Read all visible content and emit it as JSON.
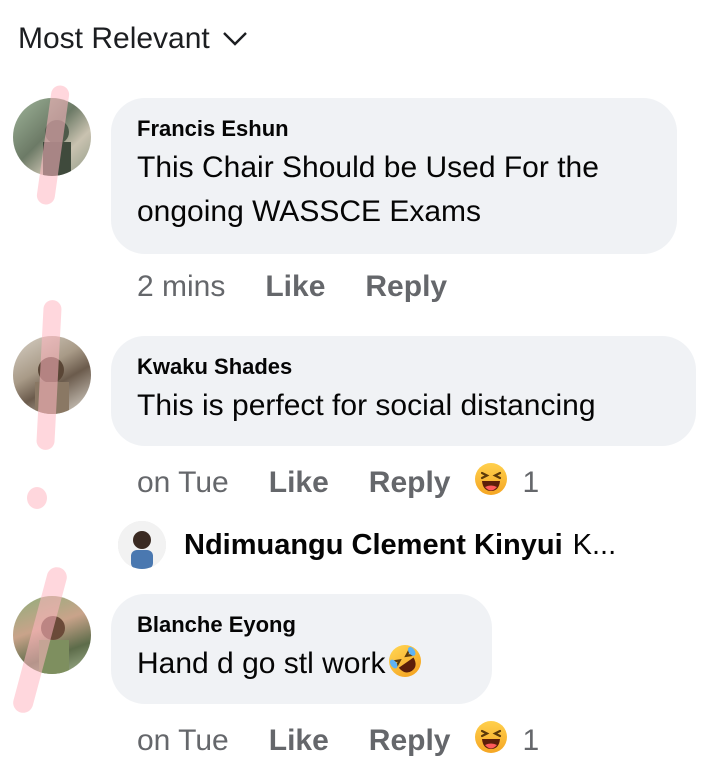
{
  "sort": {
    "label": "Most Relevant"
  },
  "comments": [
    {
      "author": "Francis Eshun",
      "text": "This Chair Should be Used For the ongoing WASSCE Exams",
      "time": "2 mins",
      "like_label": "Like",
      "reply_label": "Reply"
    },
    {
      "author": "Kwaku Shades",
      "text": "This is perfect for social distancing",
      "time": "on Tue",
      "like_label": "Like",
      "reply_label": "Reply",
      "reaction": {
        "icon": "laughing-emoji-icon",
        "count": "1"
      },
      "reply_preview": {
        "author": "Ndimuangu Clement Kinyui",
        "text": "K..."
      }
    },
    {
      "author": "Blanche Eyong",
      "text": "Hand d go stl work",
      "emoji": "rolling-on-floor-laughing-emoji-icon",
      "time": "on Tue",
      "like_label": "Like",
      "reply_label": "Reply",
      "reaction": {
        "icon": "laughing-emoji-icon",
        "count": "1"
      }
    }
  ],
  "colors": {
    "bubble": "#f0f2f5",
    "meta": "#65676b",
    "text": "#050505",
    "annotation": "#ffb6c1"
  }
}
